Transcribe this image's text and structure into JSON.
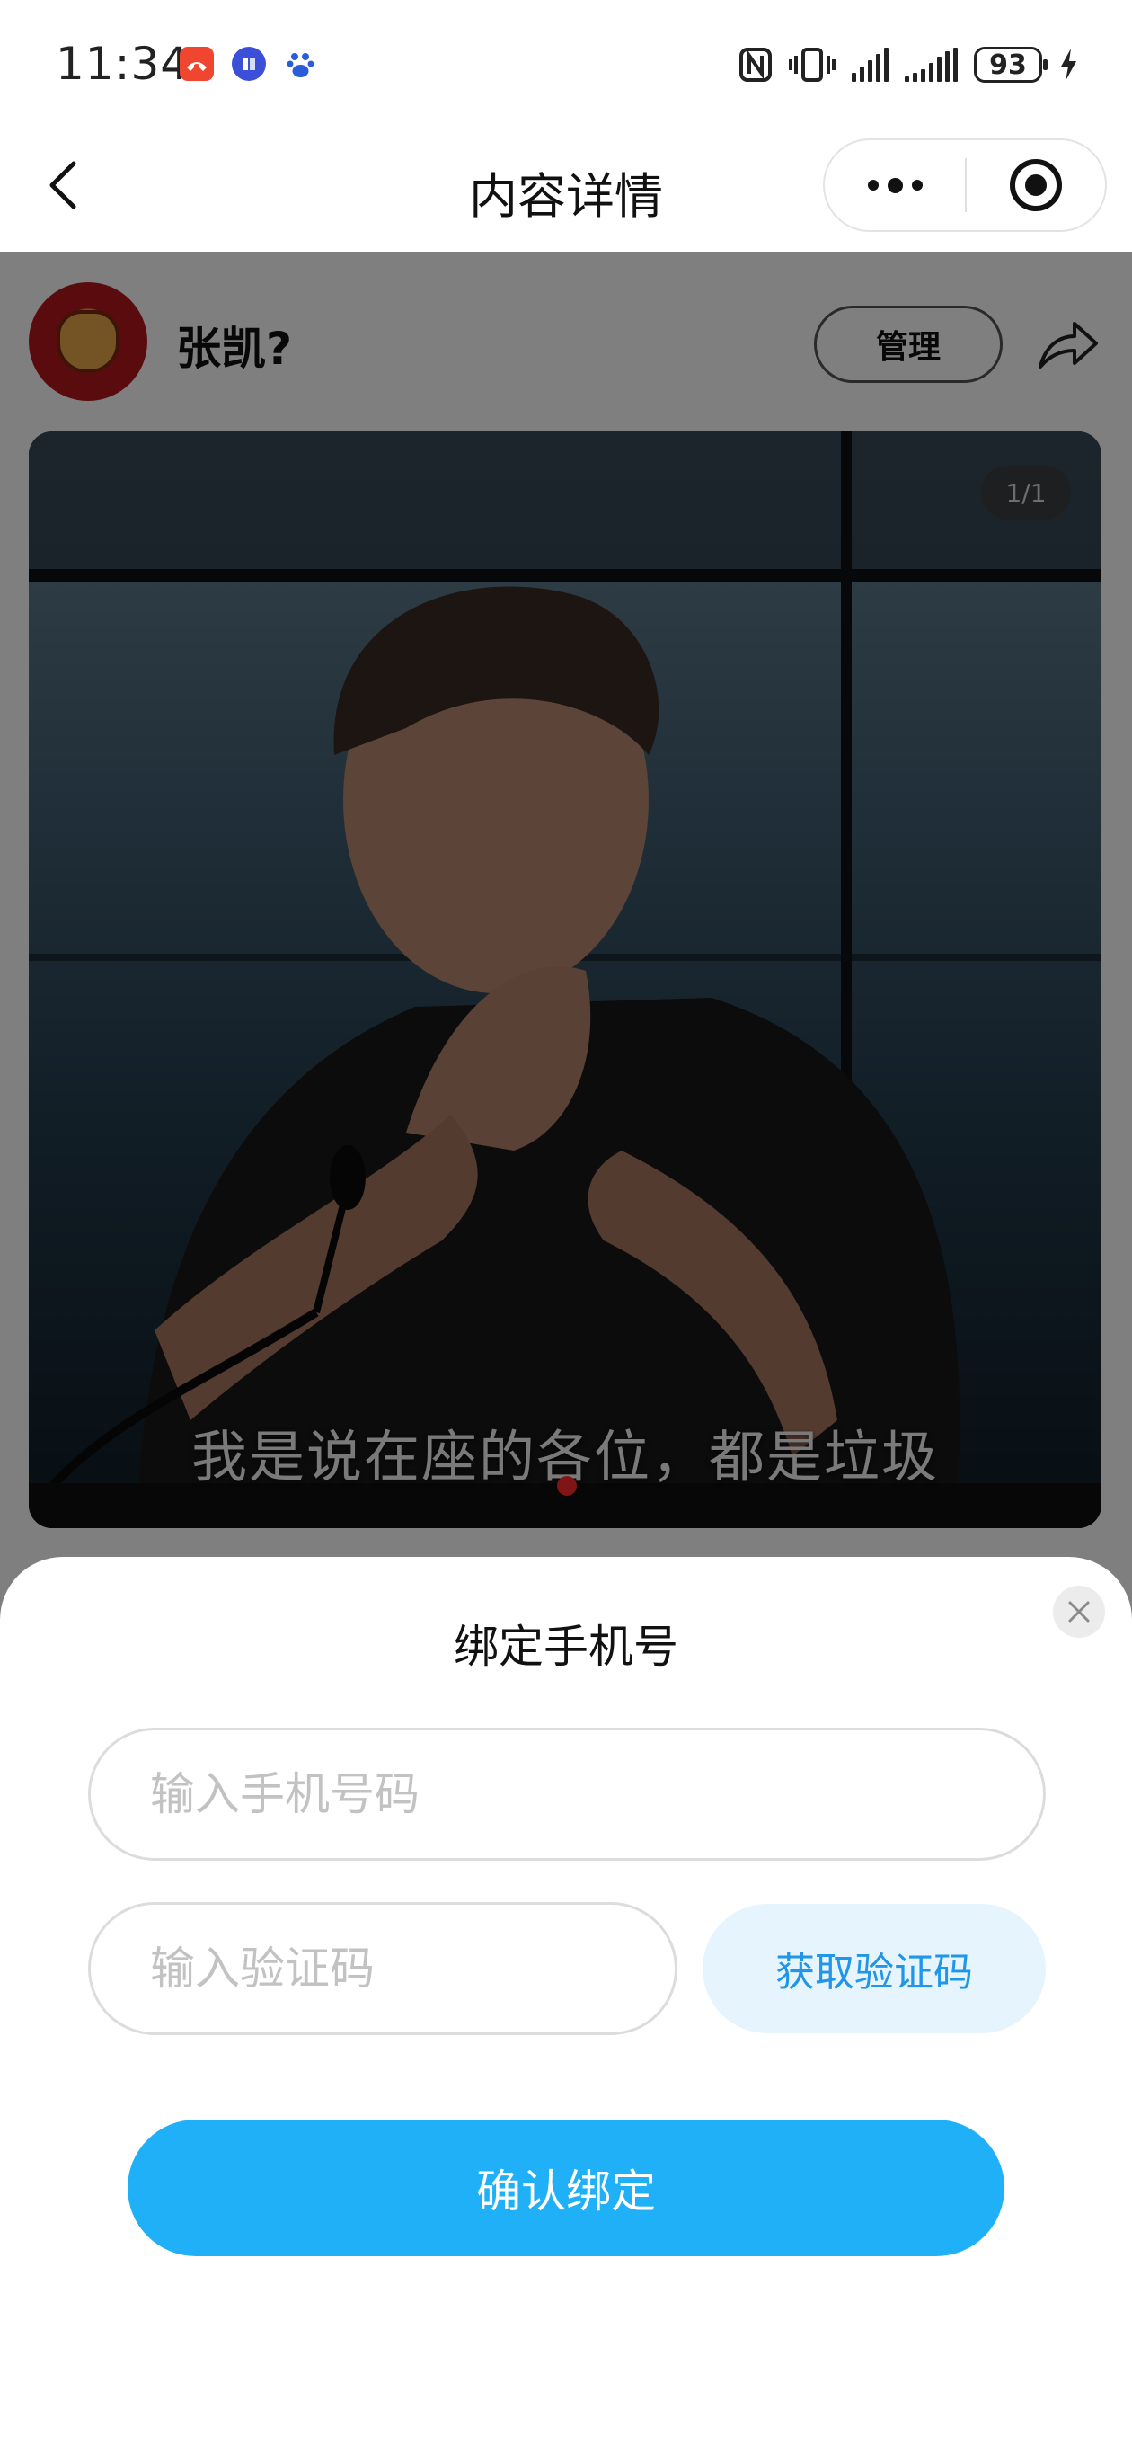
{
  "status_bar": {
    "time": "11:34",
    "battery": "93",
    "app_icons": [
      "missed-call-icon",
      "tieba-icon",
      "baidu-icon"
    ]
  },
  "nav": {
    "title": "内容详情"
  },
  "post": {
    "author_name": "张凯?",
    "manage_label": "管理",
    "page_indicator": "1/1",
    "image_caption": "我是说在座的各位，都是垃圾"
  },
  "bind_sheet": {
    "title": "绑定手机号",
    "phone_placeholder": "输入手机号码",
    "code_placeholder": "输入验证码",
    "get_code_label": "获取验证码",
    "confirm_label": "确认绑定"
  },
  "colors": {
    "primary_button": "#1fb0f7",
    "secondary_button_bg": "#e6f4fd",
    "secondary_button_text": "#2196e8",
    "carousel_dot": "#ff2a2a"
  }
}
